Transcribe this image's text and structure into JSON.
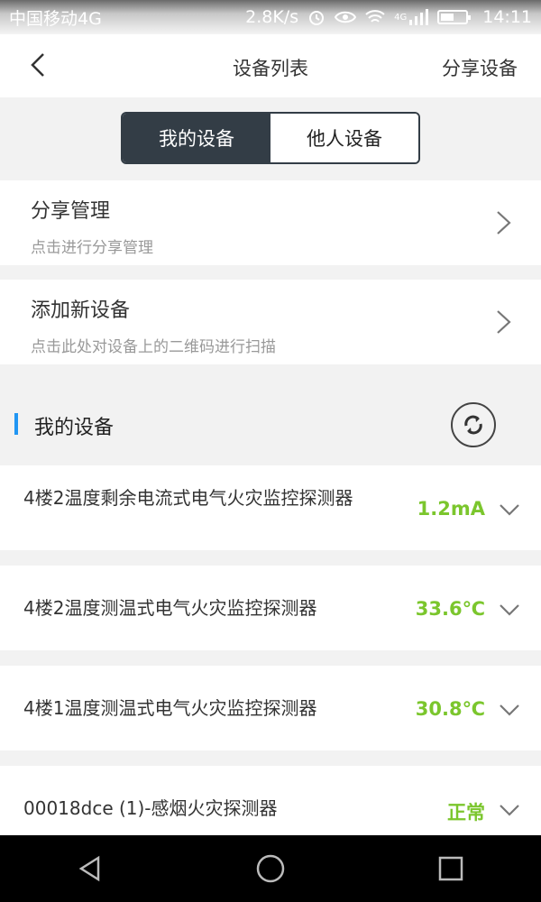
{
  "status_bar": {
    "carrier": "中国移动4G",
    "speed": "2.8K/s",
    "network": "4G",
    "time": "14:11"
  },
  "header": {
    "title": "设备列表",
    "share_label": "分享设备",
    "back_icon": "chevron-left-icon"
  },
  "segments": [
    {
      "label": "我的设备",
      "active": true
    },
    {
      "label": "他人设备",
      "active": false
    }
  ],
  "menu": [
    {
      "title": "分享管理",
      "subtitle": "点击进行分享管理"
    },
    {
      "title": "添加新设备",
      "subtitle": "点击此处对设备上的二维码进行扫描"
    }
  ],
  "section": {
    "title": "我的设备",
    "accent": "#2196f3",
    "refresh_icon": "refresh-icon"
  },
  "devices": [
    {
      "name": "4楼2温度剩余电流式电气火灾监控探测器",
      "value": "1.2mA"
    },
    {
      "name": "4楼2温度测温式电气火灾监控探测器",
      "value": "33.6℃"
    },
    {
      "name": "4楼1温度测温式电气火灾监控探测器",
      "value": "30.8℃"
    },
    {
      "name": "00018dce (1)-感烟火灾探测器",
      "value": "正常"
    }
  ],
  "colors": {
    "value_green": "#7bc62d",
    "segment_active": "#333d46"
  }
}
